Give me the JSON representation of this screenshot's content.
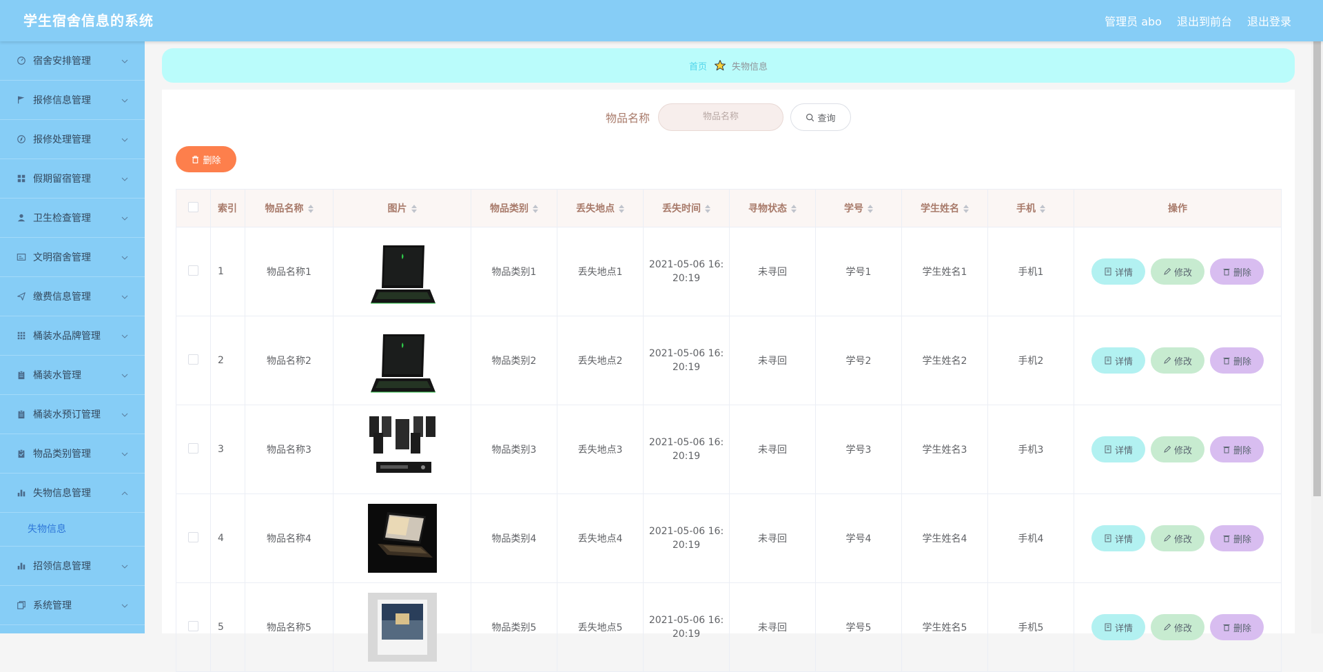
{
  "header": {
    "title": "学生宿舍信息的系统",
    "admin": "管理员 abo",
    "front": "退出到前台",
    "logout": "退出登录"
  },
  "sidebar": {
    "items": [
      {
        "label": "宿舍安排管理",
        "icon": "dashboard-icon"
      },
      {
        "label": "报修信息管理",
        "icon": "flag-icon"
      },
      {
        "label": "报修处理管理",
        "icon": "compass-icon"
      },
      {
        "label": "假期留宿管理",
        "icon": "grid-icon"
      },
      {
        "label": "卫生检查管理",
        "icon": "user-icon"
      },
      {
        "label": "文明宿舍管理",
        "icon": "card-icon"
      },
      {
        "label": "缴费信息管理",
        "icon": "send-icon"
      },
      {
        "label": "桶装水品牌管理",
        "icon": "apps-icon"
      },
      {
        "label": "桶装水管理",
        "icon": "clipboard-icon"
      },
      {
        "label": "桶装水预订管理",
        "icon": "clipboard-icon"
      },
      {
        "label": "物品类别管理",
        "icon": "clipboard-check-icon"
      },
      {
        "label": "失物信息管理",
        "icon": "bar-chart-icon"
      },
      {
        "label": "招领信息管理",
        "icon": "bar-chart-icon"
      },
      {
        "label": "系统管理",
        "icon": "copy-icon"
      }
    ],
    "sub_item": "失物信息"
  },
  "breadcrumb": {
    "home": "首页",
    "current": "失物信息"
  },
  "search": {
    "label": "物品名称",
    "placeholder": "物品名称",
    "button": "查询"
  },
  "toolbar": {
    "delete_label": "删除"
  },
  "table": {
    "headers": [
      "索引",
      "物品名称",
      "图片",
      "物品类别",
      "丢失地点",
      "丢失时间",
      "寻物状态",
      "学号",
      "学生姓名",
      "手机",
      "操作"
    ],
    "rows": [
      {
        "index": "1",
        "name": "物品名称1",
        "image": "laptop",
        "category": "物品类别1",
        "place": "丢失地点1",
        "time_a": "2021-05-06 16:",
        "time_b": "20:19",
        "status": "未寻回",
        "sid": "学号1",
        "student": "学生姓名1",
        "phone": "手机1"
      },
      {
        "index": "2",
        "name": "物品名称2",
        "image": "laptop",
        "category": "物品类别2",
        "place": "丢失地点2",
        "time_a": "2021-05-06 16:",
        "time_b": "20:19",
        "status": "未寻回",
        "sid": "学号2",
        "student": "学生姓名2",
        "phone": "手机2"
      },
      {
        "index": "3",
        "name": "物品名称3",
        "image": "speakers",
        "category": "物品类别3",
        "place": "丢失地点3",
        "time_a": "2021-05-06 16:",
        "time_b": "20:19",
        "status": "未寻回",
        "sid": "学号3",
        "student": "学生姓名3",
        "phone": "手机3"
      },
      {
        "index": "4",
        "name": "物品名称4",
        "image": "laptop-open",
        "category": "物品类别4",
        "place": "丢失地点4",
        "time_a": "2021-05-06 16:",
        "time_b": "20:19",
        "status": "未寻回",
        "sid": "学号4",
        "student": "学生姓名4",
        "phone": "手机4"
      },
      {
        "index": "5",
        "name": "物品名称5",
        "image": "photo",
        "category": "物品类别5",
        "place": "丢失地点5",
        "time_a": "2021-05-06 16:",
        "time_b": "20:19",
        "status": "未寻回",
        "sid": "学号5",
        "student": "学生姓名5",
        "phone": "手机5"
      }
    ],
    "actions": {
      "detail": "详情",
      "edit": "修改",
      "delete": "删除"
    }
  },
  "colors": {
    "header_bg": "#86cdf6",
    "breadcrumb_bg": "#bafcfb",
    "delete_btn": "#fd7f4c",
    "detail_btn": "#b2f1f1",
    "edit_btn": "#c7ebd0",
    "remove_btn": "#d8bdf0"
  }
}
